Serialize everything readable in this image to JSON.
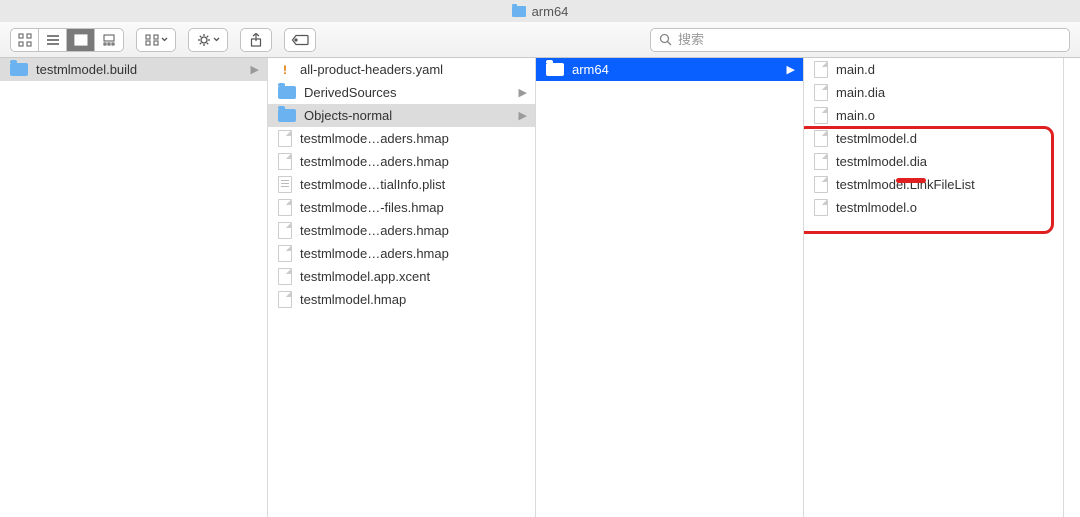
{
  "title": "arm64",
  "search": {
    "placeholder": "搜索"
  },
  "columns": {
    "col1": [
      {
        "name": "testmlmodel.build",
        "type": "folder",
        "selected": "gray",
        "hasChildren": true
      }
    ],
    "col2": [
      {
        "name": "all-product-headers.yaml",
        "type": "yaml"
      },
      {
        "name": "DerivedSources",
        "type": "folder",
        "hasChildren": true
      },
      {
        "name": "Objects-normal",
        "type": "folder",
        "selected": "gray",
        "hasChildren": true
      },
      {
        "name": "testmlmode…aders.hmap",
        "type": "file"
      },
      {
        "name": "testmlmode…aders.hmap",
        "type": "file"
      },
      {
        "name": "testmlmode…tialInfo.plist",
        "type": "plist"
      },
      {
        "name": "testmlmode…-files.hmap",
        "type": "file"
      },
      {
        "name": "testmlmode…aders.hmap",
        "type": "file"
      },
      {
        "name": "testmlmode…aders.hmap",
        "type": "file"
      },
      {
        "name": "testmlmodel.app.xcent",
        "type": "file"
      },
      {
        "name": "testmlmodel.hmap",
        "type": "file"
      }
    ],
    "col3": [
      {
        "name": "arm64",
        "type": "folder",
        "selected": "blue",
        "hasChildren": true
      }
    ],
    "col4": [
      {
        "name": "main.d",
        "type": "file"
      },
      {
        "name": "main.dia",
        "type": "file"
      },
      {
        "name": "main.o",
        "type": "file"
      },
      {
        "name": "testmlmodel.d",
        "type": "file"
      },
      {
        "name": "testmlmodel.dia",
        "type": "file"
      },
      {
        "name": "testmlmodel.LinkFileList",
        "type": "file"
      },
      {
        "name": "testmlmodel.o",
        "type": "file"
      }
    ]
  }
}
